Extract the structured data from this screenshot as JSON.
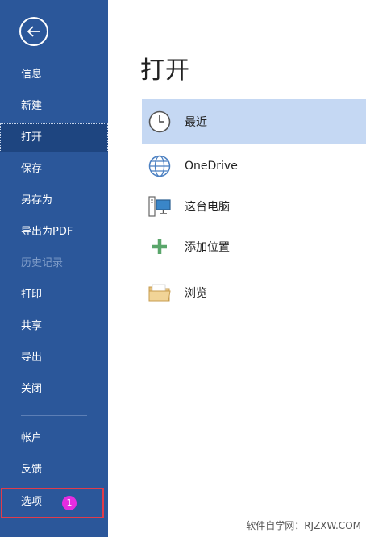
{
  "sidebar": {
    "items": [
      {
        "id": "info",
        "label": "信息",
        "enabled": true
      },
      {
        "id": "new",
        "label": "新建",
        "enabled": true
      },
      {
        "id": "open",
        "label": "打开",
        "enabled": true,
        "selected": true
      },
      {
        "id": "save",
        "label": "保存",
        "enabled": true
      },
      {
        "id": "save-as",
        "label": "另存为",
        "enabled": true
      },
      {
        "id": "export-pdf",
        "label": "导出为PDF",
        "enabled": true
      },
      {
        "id": "history",
        "label": "历史记录",
        "enabled": false
      },
      {
        "id": "print",
        "label": "打印",
        "enabled": true
      },
      {
        "id": "share",
        "label": "共享",
        "enabled": true
      },
      {
        "id": "export",
        "label": "导出",
        "enabled": true
      },
      {
        "id": "close",
        "label": "关闭",
        "enabled": true
      }
    ],
    "bottom_items": [
      {
        "id": "account",
        "label": "帐户"
      },
      {
        "id": "feedback",
        "label": "反馈"
      },
      {
        "id": "options",
        "label": "选项"
      }
    ],
    "step_badge": "1"
  },
  "main": {
    "title": "打开",
    "locations": [
      {
        "id": "recent",
        "label": "最近",
        "icon": "clock-icon",
        "selected": true
      },
      {
        "id": "onedrive",
        "label": "OneDrive",
        "icon": "globe-icon"
      },
      {
        "id": "this-pc",
        "label": "这台电脑",
        "icon": "computer-icon"
      },
      {
        "id": "add-place",
        "label": "添加位置",
        "icon": "plus-icon"
      },
      {
        "id": "browse",
        "label": "浏览",
        "icon": "folder-icon"
      }
    ]
  },
  "watermark": "软件自学网：RJZXW.COM",
  "colors": {
    "sidebar_bg": "#2b579a",
    "sidebar_selected": "#1e4580",
    "content_selected": "#c5d8f3",
    "highlight_border": "#e03c4a",
    "badge": "#e62ce0"
  }
}
